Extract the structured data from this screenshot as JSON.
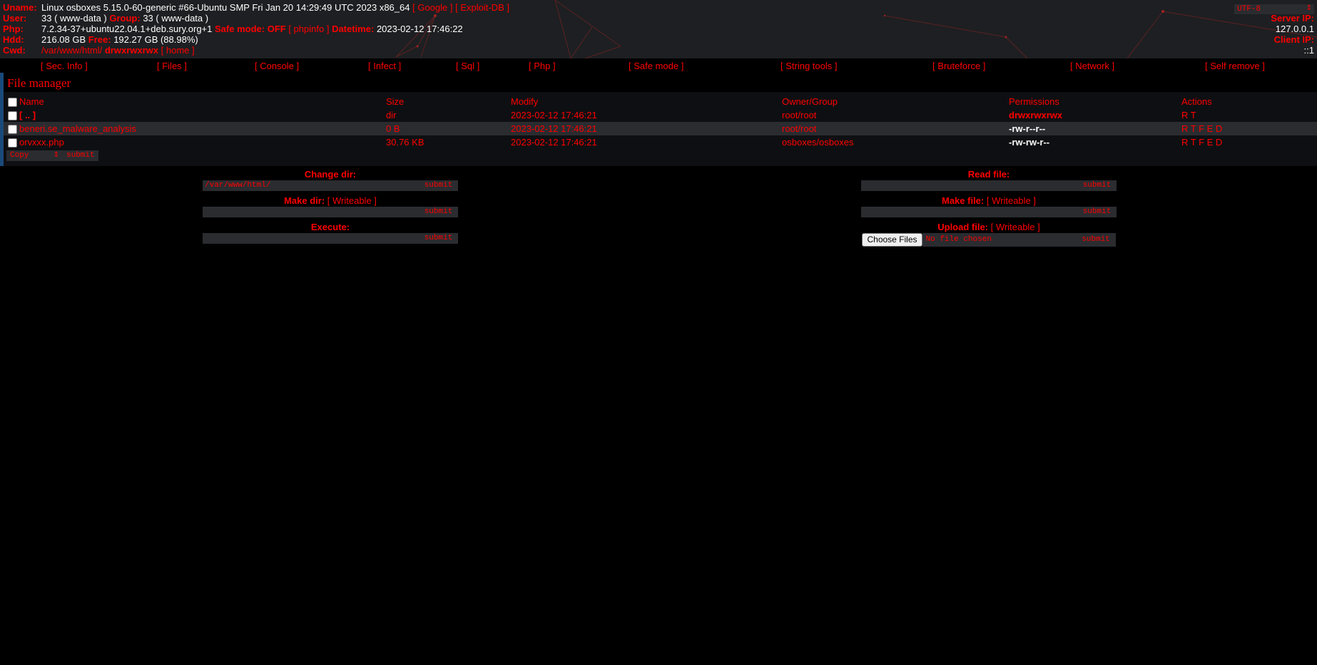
{
  "header": {
    "uname_label": "Uname:",
    "uname_value": "Linux osboxes 5.15.0-60-generic #66-Ubuntu SMP Fri Jan 20 14:29:49 UTC 2023 x86_64",
    "google_link": "[ Google ]",
    "exploitdb_link": "[ Exploit-DB ]",
    "user_label": "User:",
    "user_value": "33 ( www-data )",
    "group_label": "Group:",
    "group_value": "33 ( www-data )",
    "php_label": "Php:",
    "php_value": "7.2.34-37+ubuntu22.04.1+deb.sury.org+1",
    "safe_mode_label": "Safe mode:",
    "safe_mode_value": "OFF",
    "phpinfo_link": "[ phpinfo ]",
    "datetime_label": "Datetime:",
    "datetime_value": "2023-02-12 17:46:22",
    "hdd_label": "Hdd:",
    "hdd_value": "216.08 GB",
    "free_label": "Free:",
    "free_value": "192.27 GB (88.98%)",
    "cwd_label": "Cwd:",
    "cwd_path": "/var/www/html/",
    "cwd_perms": "drwxrwxrwx",
    "home_link": "[ home ]",
    "charset": "UTF-8",
    "server_ip_label": "Server IP:",
    "server_ip": "127.0.0.1",
    "client_ip_label": "Client IP:",
    "client_ip": "::1"
  },
  "menu": [
    "[ Sec. Info ]",
    "[ Files ]",
    "[ Console ]",
    "[ Infect ]",
    "[ Sql ]",
    "[ Php ]",
    "[ Safe mode ]",
    "[ String tools ]",
    "[ Bruteforce ]",
    "[ Network ]",
    "[ Self remove ]"
  ],
  "file_manager": {
    "title": "File manager",
    "columns": [
      "Name",
      "Size",
      "Modify",
      "Owner/Group",
      "Permissions",
      "Actions"
    ],
    "rows": [
      {
        "name": "[ .. ]",
        "size": "dir",
        "modify": "2023-02-12 17:46:21",
        "owner": "root/root",
        "perms": "drwxrwxrwx",
        "actions": "R T"
      },
      {
        "name": "beneri.se_malware_analysis",
        "size": "0 B",
        "modify": "2023-02-12 17:46:21",
        "owner": "root/root",
        "perms": "-rw-r--r--",
        "actions": "R T F E D"
      },
      {
        "name": "orvxxx.php",
        "size": "30.76 KB",
        "modify": "2023-02-12 17:46:21",
        "owner": "osboxes/osboxes",
        "perms": "-rw-rw-r--",
        "actions": "R T F E D"
      }
    ],
    "bulk_action": "Copy",
    "bulk_submit": "submit"
  },
  "forms": {
    "change_dir": {
      "label": "Change dir:",
      "value": "/var/www/html/",
      "submit": "submit"
    },
    "make_dir": {
      "label": "Make dir:",
      "note": "[ Writeable ]",
      "value": "",
      "submit": "submit"
    },
    "execute": {
      "label": "Execute:",
      "value": "",
      "submit": "submit"
    },
    "read_file": {
      "label": "Read file:",
      "value": "",
      "submit": "submit"
    },
    "make_file": {
      "label": "Make file:",
      "note": "[ Writeable ]",
      "value": "",
      "submit": "submit"
    },
    "upload_file": {
      "label": "Upload file:",
      "note": "[ Writeable ]",
      "choose": "Choose Files",
      "status": "No file chosen",
      "submit": "submit"
    }
  },
  "colors": {
    "accent": "#ff0000",
    "header_bg": "#1e1f22",
    "field_bg": "#2a2c30"
  }
}
